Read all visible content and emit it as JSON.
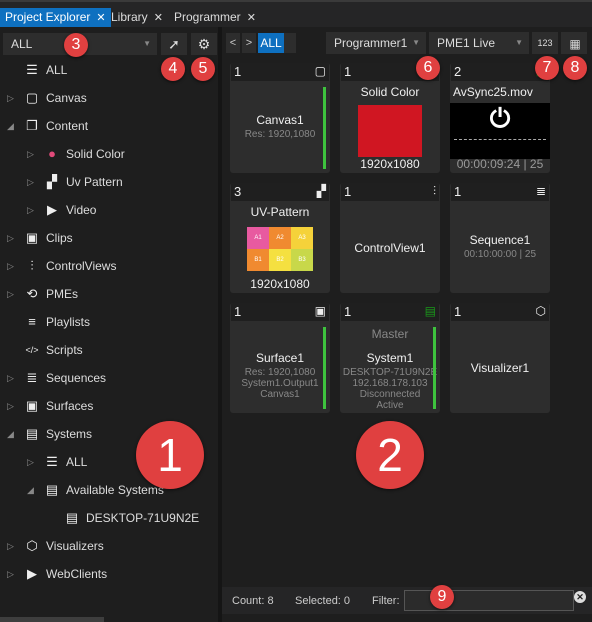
{
  "tabs": [
    {
      "label": "Project Explorer",
      "active": true
    },
    {
      "label": "Library",
      "active": false
    },
    {
      "label": "Programmer",
      "active": false
    }
  ],
  "left": {
    "filter_value": "ALL",
    "tree": [
      {
        "label": "ALL",
        "icon": "database-icon",
        "level": 0,
        "expander": "none"
      },
      {
        "label": "Canvas",
        "icon": "canvas-icon",
        "level": 0,
        "expander": "collapsed"
      },
      {
        "label": "Content",
        "icon": "content-icon",
        "level": 0,
        "expander": "expanded"
      },
      {
        "label": "Solid Color",
        "icon": "color-icon",
        "level": 1,
        "expander": "collapsed"
      },
      {
        "label": "Uv Pattern",
        "icon": "checker-icon",
        "level": 1,
        "expander": "collapsed"
      },
      {
        "label": "Video",
        "icon": "video-icon",
        "level": 1,
        "expander": "collapsed"
      },
      {
        "label": "Clips",
        "icon": "clips-icon",
        "level": 0,
        "expander": "collapsed"
      },
      {
        "label": "ControlViews",
        "icon": "sliders-icon",
        "level": 0,
        "expander": "collapsed"
      },
      {
        "label": "PMEs",
        "icon": "pme-icon",
        "level": 0,
        "expander": "collapsed"
      },
      {
        "label": "Playlists",
        "icon": "playlist-icon",
        "level": 0,
        "expander": "none"
      },
      {
        "label": "Scripts",
        "icon": "code-icon",
        "level": 0,
        "expander": "none"
      },
      {
        "label": "Sequences",
        "icon": "sequence-icon",
        "level": 0,
        "expander": "collapsed"
      },
      {
        "label": "Surfaces",
        "icon": "surface-icon",
        "level": 0,
        "expander": "collapsed"
      },
      {
        "label": "Systems",
        "icon": "server-icon",
        "level": 0,
        "expander": "expanded"
      },
      {
        "label": "ALL",
        "icon": "database-icon",
        "level": 1,
        "expander": "collapsed"
      },
      {
        "label": "Available Systems",
        "icon": "server-icon",
        "level": 1,
        "expander": "expanded"
      },
      {
        "label": "DESKTOP-71U9N2E",
        "icon": "server-icon",
        "level": 2,
        "expander": "none"
      },
      {
        "label": "Visualizers",
        "icon": "cube-icon",
        "level": 0,
        "expander": "collapsed"
      },
      {
        "label": "WebClients",
        "icon": "webclient-icon",
        "level": 0,
        "expander": "collapsed"
      }
    ]
  },
  "main": {
    "nav": {
      "prev": "<",
      "next": ">",
      "all": "ALL"
    },
    "programmer_select": "Programmer1",
    "pme_select": "PME1 Live",
    "numbers_button": "123",
    "tiles": [
      {
        "count": "1",
        "icon": "canvas-icon",
        "title": "Canvas1",
        "sub": [
          "Res: 1920,1080"
        ],
        "preview": "none",
        "active": true
      },
      {
        "count": "1",
        "icon": "color-icon",
        "title": "Solid Color",
        "sub": [],
        "preview": "red",
        "caption": "1920x1080",
        "active": false
      },
      {
        "count": "2",
        "icon": "video-icon",
        "title": "AvSync25.mov",
        "sub": [],
        "preview": "video",
        "caption": "00:00:09:24 | 25",
        "active": false
      },
      {
        "count": "3",
        "icon": "checker-icon",
        "title": "UV-Pattern",
        "sub": [],
        "preview": "uv",
        "caption": "1920x1080",
        "active": false
      },
      {
        "count": "1",
        "icon": "sliders-icon",
        "title": "ControlView1",
        "sub": [],
        "preview": "none",
        "active": false
      },
      {
        "count": "1",
        "icon": "sequence-icon",
        "title": "Sequence1",
        "sub": [
          "00:10:00:00 | 25"
        ],
        "preview": "none",
        "active": false
      },
      {
        "count": "1",
        "icon": "surface-icon",
        "title": "Surface1",
        "sub": [
          "Res: 1920,1080",
          "System1.Output1",
          "Canvas1"
        ],
        "preview": "none",
        "active": true
      },
      {
        "count": "1",
        "icon": "server-icon",
        "title": "System1",
        "top": "Master",
        "sub": [
          "DESKTOP-71U9N2E",
          "192.168.178.103",
          "Disconnected",
          "Active"
        ],
        "preview": "none",
        "active": true
      },
      {
        "count": "1",
        "icon": "cube-icon",
        "title": "Visualizer1",
        "sub": [],
        "preview": "none",
        "active": false
      }
    ],
    "uv_cells": [
      "A1",
      "A2",
      "A3",
      "B1",
      "B2",
      "B3"
    ],
    "uv_colors": [
      "#e85aa0",
      "#f08a30",
      "#f5d23a",
      "#f08a30",
      "#f5e040",
      "#c8d84a"
    ]
  },
  "status": {
    "count": "Count: 8",
    "selected": "Selected: 0",
    "filter_label": "Filter:",
    "filter_value": ""
  },
  "colors": {
    "accent": "#0e70c0",
    "active_bar": "#3ec33e",
    "badge": "#e04040",
    "solid": "#d01622"
  },
  "badges": [
    "1",
    "2",
    "3",
    "4",
    "5",
    "6",
    "7",
    "8",
    "9"
  ]
}
